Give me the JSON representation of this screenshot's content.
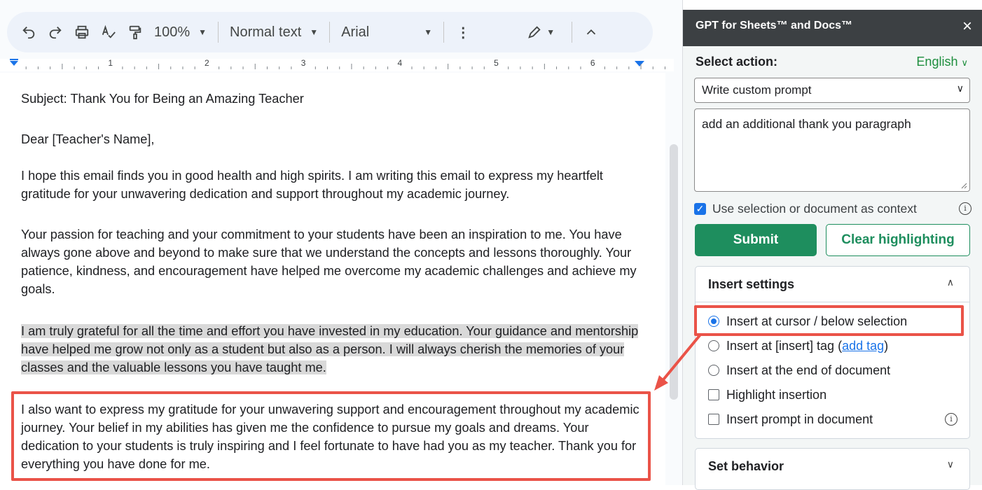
{
  "toolbar": {
    "zoom": "100%",
    "style": "Normal text",
    "font": "Arial",
    "more": "⋮",
    "edit_icon": "pencil-icon"
  },
  "ruler": {
    "marks": [
      "1",
      "2",
      "3",
      "4",
      "5",
      "6"
    ]
  },
  "document": {
    "subject": "Subject: Thank You for Being an Amazing Teacher",
    "greeting": "Dear [Teacher's Name],",
    "p1": "I hope this email finds you in good health and high spirits. I am writing this email to express my heartfelt gratitude for your unwavering dedication and support throughout my academic journey.",
    "p2": "Your passion for teaching and your commitment to your students have been an inspiration to me. You have always gone above and beyond to make sure that we understand the concepts and lessons thoroughly. Your patience, kindness, and encouragement have helped me overcome my academic challenges and achieve my goals.",
    "p3_highlighted": "I am truly grateful for all the time and effort you have invested in my education. Your guidance and mentorship have helped me grow not only as a student but also as a person. I will always cherish the memories of your classes and the valuable lessons you have taught me.",
    "p4_inserted": "I also want to express my gratitude for your unwavering support and encouragement throughout my academic journey. Your belief in my abilities has given me the confidence to pursue my goals and dreams. Your dedication to your students is truly inspiring and I feel fortunate to have had you as my teacher. Thank you for everything you have done for me."
  },
  "panel": {
    "title": "GPT for Sheets™ and Docs™",
    "close": "×",
    "select_label": "Select action:",
    "language": "English",
    "action": "Write custom prompt",
    "prompt": "add an additional thank you paragraph",
    "context_label": "Use selection or document as context",
    "context_checked": true,
    "submit": "Submit",
    "clear": "Clear highlighting",
    "insert_settings": {
      "title": "Insert settings",
      "options": [
        {
          "label": "Insert at cursor / below selection",
          "type": "radio",
          "selected": true
        },
        {
          "label": "Insert at [insert] tag (",
          "link": "add tag",
          "suffix": ")",
          "type": "radio",
          "selected": false
        },
        {
          "label": "Insert at the end of document",
          "type": "radio",
          "selected": false
        },
        {
          "label": "Highlight insertion",
          "type": "checkbox",
          "checked": false
        },
        {
          "label": "Insert prompt in document",
          "type": "checkbox",
          "checked": false
        }
      ]
    },
    "set_behavior": {
      "title": "Set behavior"
    }
  },
  "colors": {
    "accent_green": "#1e8e5e",
    "annotation_red": "#ea5348",
    "highlight_gray": "#d9d9d9",
    "header_dark": "#3c4043"
  }
}
